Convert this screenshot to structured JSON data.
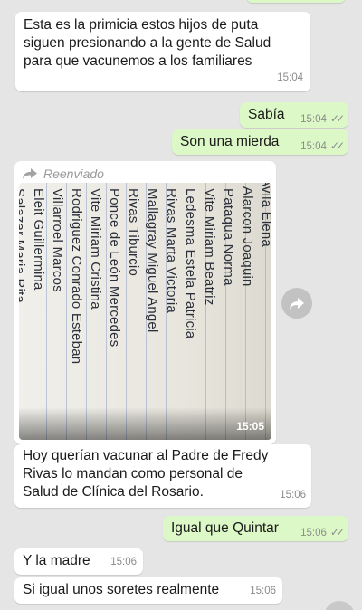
{
  "messages": [
    {
      "text": "Esta es la primicia estos hijos de puta siguen presionando a la gente de Salud para que vacunemos a los familiares",
      "lines": [
        "Esta es la primicia estos hijos de puta",
        "siguen presionando a la gente de Salud",
        "para que vacunemos a los familiares"
      ],
      "time": "15:04"
    },
    {
      "text": "Sabía",
      "time": "15:04"
    },
    {
      "text": "Son una mierda",
      "time": "15:04"
    },
    {
      "forwarded_label": "Reenviado",
      "photo_time": "15:05",
      "photo_lines": [
        "Avila Elena",
        "Alarcon Joaquin",
        "Pataqua Norma",
        "Vite Miriam Beatriz",
        "Ledesma Estela Patricia",
        "Rivas Marta Victoria",
        "Mallagray Miguel Angel",
        "Rivas Tiburcio",
        "Ponce de León Mercedes",
        "Vite Miriam Cristina",
        "Rodriguez Conrado Esteban",
        "Villarroel Marcos",
        "Eleit Guillermina",
        "Salazar Maria Rita"
      ]
    },
    {
      "lines": [
        "Hoy querían vacunar al Padre de Fredy",
        "Rivas lo mandan  como personal de",
        "Salud de Clínica del Rosario."
      ],
      "time": "15:06"
    },
    {
      "text": "Igual que Quintar",
      "time": "15:06"
    },
    {
      "text": "Y la madre",
      "time": "15:06"
    },
    {
      "text": "Si igual unos soretes realmente",
      "time": "15:06"
    }
  ],
  "icons": {
    "forward": "forward-arrow-icon",
    "share": "share-icon",
    "read": "double-check-icon"
  },
  "colors": {
    "incoming": "#ffffff",
    "outgoing": "#dcf8c6",
    "background": "#e5e5e5"
  }
}
